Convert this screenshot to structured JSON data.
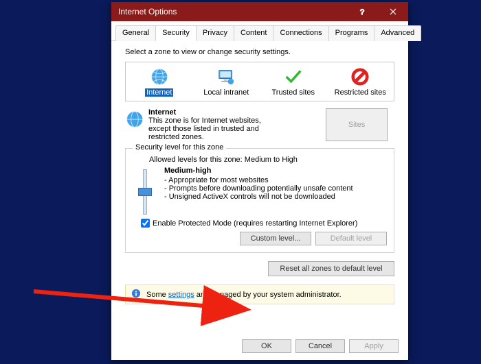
{
  "title": "Internet Options",
  "tabs": [
    "General",
    "Security",
    "Privacy",
    "Content",
    "Connections",
    "Programs",
    "Advanced"
  ],
  "active_tab_index": 1,
  "zone_prompt": "Select a zone to view or change security settings.",
  "zones": {
    "internet": "Internet",
    "local": "Local intranet",
    "trusted": "Trusted sites",
    "restricted": "Restricted sites"
  },
  "selected_zone": "internet",
  "zone_detail": {
    "title": "Internet",
    "desc": "This zone is for Internet websites, except those listed in trusted and restricted zones."
  },
  "sites_label": "Sites",
  "group_title": "Security level for this zone",
  "allowed_levels": "Allowed levels for this zone: Medium to High",
  "level": {
    "name": "Medium-high",
    "b1": "- Appropriate for most websites",
    "b2": "- Prompts before downloading potentially unsafe content",
    "b3": "- Unsigned ActiveX controls will not be downloaded"
  },
  "protected_mode_label": "Enable Protected Mode (requires restarting Internet Explorer)",
  "protected_mode_checked": true,
  "custom_level_label": "Custom level...",
  "default_level_label": "Default level",
  "reset_label": "Reset all zones to default level",
  "notice_pre": "Some ",
  "notice_link": "settings",
  "notice_post": " are managed by your system administrator.",
  "footer": {
    "ok": "OK",
    "cancel": "Cancel",
    "apply": "Apply"
  }
}
